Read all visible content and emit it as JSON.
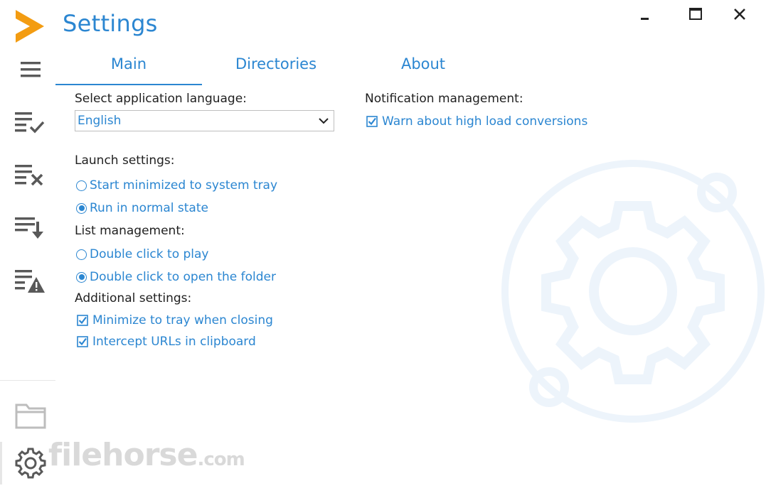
{
  "window": {
    "title": "Settings",
    "controls": {
      "minimize": "minimize",
      "maximize": "maximize",
      "close": "close"
    }
  },
  "colors": {
    "accent": "#2b86d1",
    "logo": "#f39c12",
    "icon_gray": "#595959"
  },
  "sidebar": {
    "items": [
      {
        "icon": "menu-icon"
      },
      {
        "icon": "list-check-icon"
      },
      {
        "icon": "list-remove-icon"
      },
      {
        "icon": "list-download-icon"
      },
      {
        "icon": "list-warning-icon"
      }
    ],
    "bottom": [
      {
        "icon": "folder-icon"
      },
      {
        "icon": "gear-icon"
      }
    ]
  },
  "tabs": [
    {
      "label": "Main",
      "active": true
    },
    {
      "label": "Directories",
      "active": false
    },
    {
      "label": "About",
      "active": false
    }
  ],
  "main": {
    "language": {
      "label": "Select application language:",
      "value": "English"
    },
    "launch": {
      "label": "Launch settings:",
      "options": [
        {
          "label": "Start minimized to system tray",
          "selected": false
        },
        {
          "label": "Run in normal state",
          "selected": true
        }
      ]
    },
    "list": {
      "label": "List management:",
      "options": [
        {
          "label": "Double click to play",
          "selected": false
        },
        {
          "label": "Double click to open the folder",
          "selected": true
        }
      ]
    },
    "additional": {
      "label": "Additional settings:",
      "options": [
        {
          "label": "Minimize to tray when closing",
          "checked": true
        },
        {
          "label": "Intercept URLs in clipboard",
          "checked": true
        }
      ]
    },
    "notification": {
      "label": "Notification management:",
      "options": [
        {
          "label": "Warn about high load conversions",
          "checked": true
        }
      ]
    }
  },
  "watermark": {
    "text": "filehorse",
    "suffix": ".com"
  }
}
